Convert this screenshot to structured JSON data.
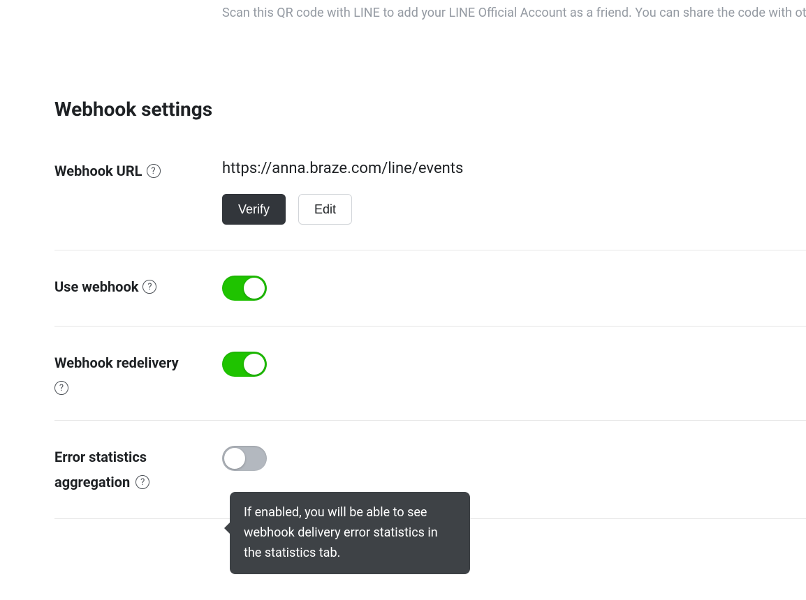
{
  "helper_text": "Scan this QR code with LINE to add your LINE Official Account as a friend. You can share the code with ot",
  "section_title": "Webhook settings",
  "webhook_url": {
    "label": "Webhook URL",
    "value": "https://anna.braze.com/line/events",
    "verify_label": "Verify",
    "edit_label": "Edit"
  },
  "use_webhook": {
    "label": "Use webhook",
    "enabled": true
  },
  "webhook_redelivery": {
    "label": "Webhook redelivery",
    "enabled": true
  },
  "error_stats": {
    "label_line1": "Error statistics",
    "label_line2": "aggregation",
    "enabled": false,
    "tooltip": "If enabled, you will be able to see webhook delivery error statistics in the statistics tab."
  }
}
